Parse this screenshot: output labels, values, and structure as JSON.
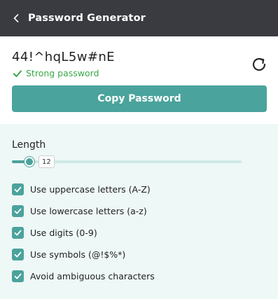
{
  "titlebar": {
    "back_icon": "chevron-left-icon",
    "title": "Password Generator"
  },
  "password": {
    "value": "44!^hqL5w#nE",
    "strength_label": "Strong password",
    "strength_icon": "check-icon",
    "refresh_icon": "refresh-icon",
    "copy_label": "Copy Password"
  },
  "options": {
    "length_label": "Length",
    "length_value": "12",
    "length_fraction": 0.075,
    "checkboxes": [
      {
        "label": "Use uppercase letters (A-Z)",
        "checked": true
      },
      {
        "label": "Use lowercase letters (a-z)",
        "checked": true
      },
      {
        "label": "Use digits (0-9)",
        "checked": true
      },
      {
        "label": "Use symbols (@!$%*)",
        "checked": true
      },
      {
        "label": "Avoid ambiguous characters",
        "checked": true
      }
    ]
  },
  "colors": {
    "accent": "#4aa39c",
    "titlebar": "#3a3b40",
    "strong": "#3aa84a",
    "options_bg": "#eef8f6"
  }
}
